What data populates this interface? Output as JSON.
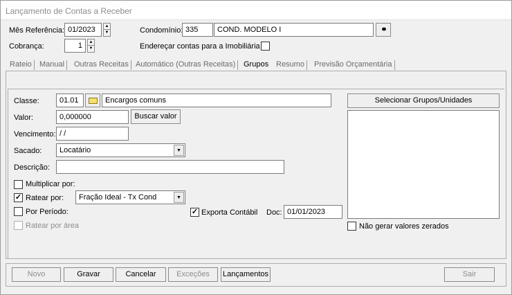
{
  "window": {
    "title": "Lançamento de Contas a Receber"
  },
  "header": {
    "mes_label": "Mês Referência:",
    "mes_value": "01/2023",
    "condominio_label": "Condomínio:",
    "condominio_code": "335",
    "condominio_name": "COND. MODELO I",
    "cobranca_label": "Cobrança:",
    "cobranca_value": "1",
    "enderecar_label": "Endereçar contas para a Imobiliária",
    "enderecar_checked": false
  },
  "tabs": [
    {
      "label": "Rateio"
    },
    {
      "label": "Manual"
    },
    {
      "label": "Outras Receitas"
    },
    {
      "label": "Automático (Outras Receitas)"
    },
    {
      "label": "Grupos",
      "active": true
    },
    {
      "label": "Resumo"
    },
    {
      "label": "Previsão Orçamentária"
    }
  ],
  "form": {
    "classe_label": "Classe:",
    "classe_code": "01.01",
    "classe_desc": "Encargos comuns",
    "valor_label": "Valor:",
    "valor_value": "0,000000",
    "buscar_button": "Buscar valor",
    "vencimento_label": "Vencimento:",
    "vencimento_value": " /  /",
    "sacado_label": "Sacado:",
    "sacado_value": "Locatário",
    "descricao_label": "Descrição:",
    "descricao_value": "",
    "multiplicar_label": "Multiplicar por:",
    "multiplicar_checked": false,
    "ratear_label": "Ratear por:",
    "ratear_checked": true,
    "ratear_value": "Fração Ideal - Tx Cond",
    "periodo_label": "Por Período:",
    "periodo_checked": false,
    "exporta_label": "Exporta Contábil",
    "exporta_checked": true,
    "doc_label": "Doc:",
    "doc_value": "01/01/2023",
    "ratear_area_label": "Ratear por área",
    "ratear_area_checked": false
  },
  "groups": {
    "select_button": "Selecionar Grupos/Unidades",
    "nao_gerar_label": "Não gerar valores zerados",
    "nao_gerar_checked": false
  },
  "footer": {
    "novo": "Novo",
    "gravar": "Gravar",
    "cancelar": "Cancelar",
    "excecoes": "Exceções",
    "lancamentos": "Lançamentos",
    "sair": "Sair"
  }
}
